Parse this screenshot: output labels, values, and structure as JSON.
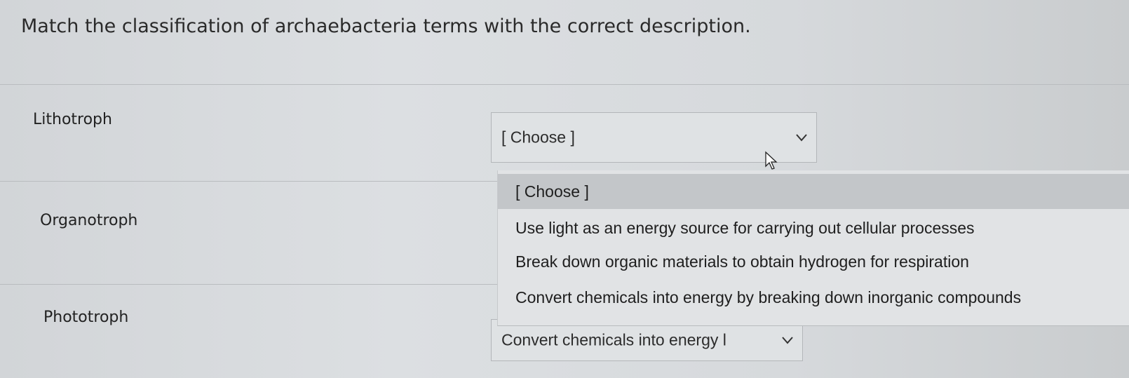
{
  "question": {
    "text": "Match the classification of archaebacteria terms with the correct description."
  },
  "rows": [
    {
      "term": "Lithotroph",
      "selected": "[ Choose ]"
    },
    {
      "term": "Organotroph"
    },
    {
      "term": "Phototroph",
      "selected": "Convert chemicals into energy l"
    }
  ],
  "dropdown": {
    "options": [
      "[ Choose ]",
      "Use light as an energy source for carrying out cellular processes",
      "Break down organic materials to obtain hydrogen for respiration",
      "Convert chemicals into energy by breaking down inorganic compounds"
    ],
    "highlighted_index": 0
  },
  "icons": {
    "chevron": "chevron-down-icon",
    "cursor": "mouse-pointer-icon"
  }
}
